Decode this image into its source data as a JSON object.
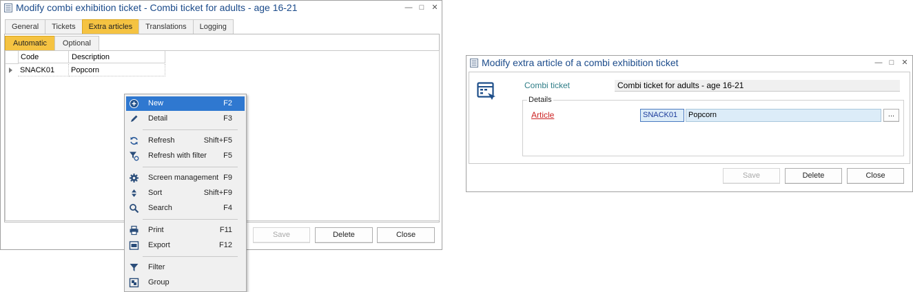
{
  "main_window": {
    "title": "Modify combi exhibition ticket  - Combi ticket for adults - age 16-21",
    "controls": {
      "minimize": "—",
      "maximize": "□",
      "close": "✕"
    },
    "tabs": [
      "General",
      "Tickets",
      "Extra articles",
      "Translations",
      "Logging"
    ],
    "active_tab": "Extra articles",
    "subtabs": [
      "Automatic",
      "Optional"
    ],
    "active_subtab": "Automatic",
    "grid": {
      "columns": [
        "Code",
        "Description"
      ],
      "rows": [
        {
          "code": "SNACK01",
          "description": "Popcorn"
        }
      ]
    },
    "buttons": {
      "save": "Save",
      "delete": "Delete",
      "close": "Close"
    }
  },
  "context_menu": {
    "items": [
      {
        "label": "New",
        "shortcut": "F2",
        "icon": "plus-circle-icon"
      },
      {
        "label": "Detail",
        "shortcut": "F3",
        "icon": "pencil-icon"
      },
      {
        "label": "Refresh",
        "shortcut": "Shift+F5",
        "icon": "refresh-icon"
      },
      {
        "label": "Refresh with filter",
        "shortcut": "F5",
        "icon": "filter-refresh-icon"
      },
      {
        "label": "Screen management",
        "shortcut": "F9",
        "icon": "gear-icon"
      },
      {
        "label": "Sort",
        "shortcut": "Shift+F9",
        "icon": "sort-icon"
      },
      {
        "label": "Search",
        "shortcut": "F4",
        "icon": "search-icon"
      },
      {
        "label": "Print",
        "shortcut": "F11",
        "icon": "print-icon"
      },
      {
        "label": "Export",
        "shortcut": "F12",
        "icon": "export-icon"
      },
      {
        "label": "Filter",
        "shortcut": "",
        "icon": "filter-icon"
      },
      {
        "label": "Group",
        "shortcut": "",
        "icon": "group-icon"
      }
    ],
    "highlighted": "New"
  },
  "detail_window": {
    "title": "Modify extra article of a combi exhibition ticket",
    "controls": {
      "minimize": "—",
      "maximize": "□",
      "close": "✕"
    },
    "combi_ticket_label": "Combi ticket",
    "combi_ticket_value": "Combi ticket for adults - age 16-21",
    "details_group": "Details",
    "article_label": "Article",
    "article_code": "SNACK01",
    "article_description": "Popcorn",
    "lookup_button": "...",
    "buttons": {
      "save": "Save",
      "delete": "Delete",
      "close": "Close"
    }
  },
  "colors": {
    "title": "#1a4a8a",
    "active_tab": "#f5c342",
    "menu_highlight": "#2f78d0",
    "label_teal": "#2e7d87",
    "article_red": "#cc2222",
    "field_fill": "#dcecf8"
  }
}
